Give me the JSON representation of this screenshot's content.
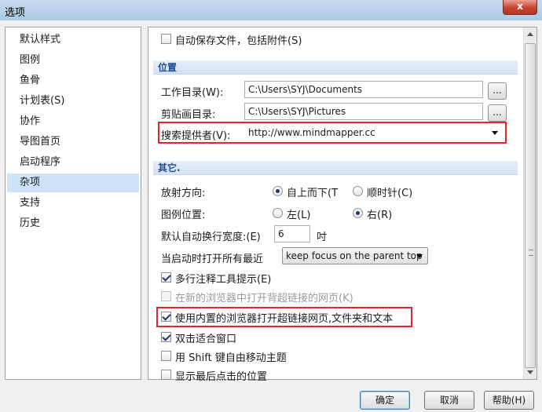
{
  "window": {
    "title": "选项",
    "close_glyph": "x"
  },
  "sidebar": {
    "items": [
      {
        "label": "默认样式"
      },
      {
        "label": "图例"
      },
      {
        "label": "鱼骨"
      },
      {
        "label": "计划表(S)"
      },
      {
        "label": "协作"
      },
      {
        "label": "导图首页"
      },
      {
        "label": "启动程序"
      },
      {
        "label": "杂项",
        "selected": true
      },
      {
        "label": "支持"
      },
      {
        "label": "历史"
      }
    ]
  },
  "panel": {
    "autosave_label": "自动保存文件，包括附件(S)",
    "autosave_checked": false,
    "location": {
      "header": "位置",
      "workdir_label": "工作目录(W):",
      "workdir_value": "C:\\Users\\SYJ\\Documents",
      "clipdir_label": "剪贴画目录:",
      "clipdir_value": "C:\\Users\\SYJ\\Pictures",
      "browse_label": "...",
      "search_label": "搜索提供者(V):",
      "search_value": "http://www.mindmapper.cc"
    },
    "other": {
      "header": "其它.",
      "radial_label": "放射方向:",
      "radial_opt1": "自上而下(T",
      "radial_opt2": "顺时针(C)",
      "radial_selected": "top-down",
      "legend_label": "图例位置:",
      "legend_opt1": "左(L)",
      "legend_opt2": "右(R)",
      "legend_selected": "right",
      "wrap_label": "默认自动换行宽度:(E)",
      "wrap_value": "6",
      "wrap_unit": "吋",
      "startup_label": "当启动时打开所有最近",
      "startup_value": "keep focus on the parent top"
    },
    "checkboxes": [
      {
        "label": "多行注释工具提示(E)",
        "checked": true,
        "disabled": false
      },
      {
        "label": "在新的浏览器中打开背超链接的网页(K)",
        "checked": false,
        "disabled": true
      },
      {
        "label": "使用内置的浏览器打开超链接网页,文件夹和文本",
        "checked": true,
        "disabled": false
      },
      {
        "label": "双击适合窗口",
        "checked": true,
        "disabled": false
      },
      {
        "label": "用 Shift 键自由移动主题",
        "checked": false,
        "disabled": false
      },
      {
        "label": "显示最后点击的位置",
        "checked": false,
        "disabled": false
      }
    ]
  },
  "buttons": {
    "ok": "确定",
    "cancel": "取消",
    "help": "帮助(H)"
  },
  "colors": {
    "highlight": "#e3262e",
    "selection": "#cde3f7",
    "section_text": "#1e4d91"
  }
}
